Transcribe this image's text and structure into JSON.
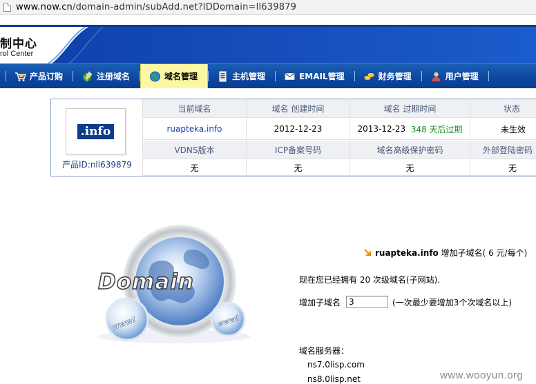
{
  "browser": {
    "url_prefix": "www.now.cn",
    "url_path": "/domain-admin/subAdd.net?IDDomain=ll639879"
  },
  "header": {
    "title_cn": "制中心",
    "title_en": "rol Center"
  },
  "nav": {
    "items": [
      {
        "label": "产品订购",
        "icon": "cart-icon",
        "active": false
      },
      {
        "label": "注册域名",
        "icon": "pen-globe-icon",
        "active": false
      },
      {
        "label": "域名管理",
        "icon": "globe-icon",
        "active": true
      },
      {
        "label": "主机管理",
        "icon": "server-icon",
        "active": false
      },
      {
        "label": "EMAIL管理",
        "icon": "envelope-icon",
        "active": false
      },
      {
        "label": "财务管理",
        "icon": "coins-icon",
        "active": false
      },
      {
        "label": "用户管理",
        "icon": "user-icon",
        "active": false
      }
    ]
  },
  "info": {
    "logo_text": ".info",
    "product_id": "产品ID:nll639879",
    "headers1": [
      "当前域名",
      "域名 创建时间",
      "域名 过期时间",
      "状态"
    ],
    "domain": "ruapteka.info",
    "created": "2012-12-23",
    "expires": "2013-12-23",
    "days_left": "348 天后过期",
    "status": "未生效",
    "headers2": [
      "VDNS版本",
      "ICP备案号码",
      "域名高级保护密码",
      "外部登陆密码"
    ],
    "values2": [
      "无",
      "无",
      "无",
      "无"
    ]
  },
  "graphic": {
    "word": "Domain",
    "ball_text": "www"
  },
  "form": {
    "domain": "ruapteka.info",
    "add_title": "增加子域名( 6 元/每个)",
    "owned_text": "现在您已经拥有 20 次级域名(子网站).",
    "add_label": "增加子域名",
    "add_value": "3",
    "add_hint": "(一次最少要增加3个次域名以上)",
    "dns_label": "域名服务器：",
    "ns1": "ns7.0lisp.com",
    "ns2": "ns8.0lisp.net"
  },
  "watermark": "www.wooyun.org",
  "colors": {
    "nav_bg": "#0c47a0",
    "active_tab": "#fbf8a3",
    "link": "#1c3fa6",
    "warn": "#e00000",
    "ok": "#1d8f1d"
  }
}
